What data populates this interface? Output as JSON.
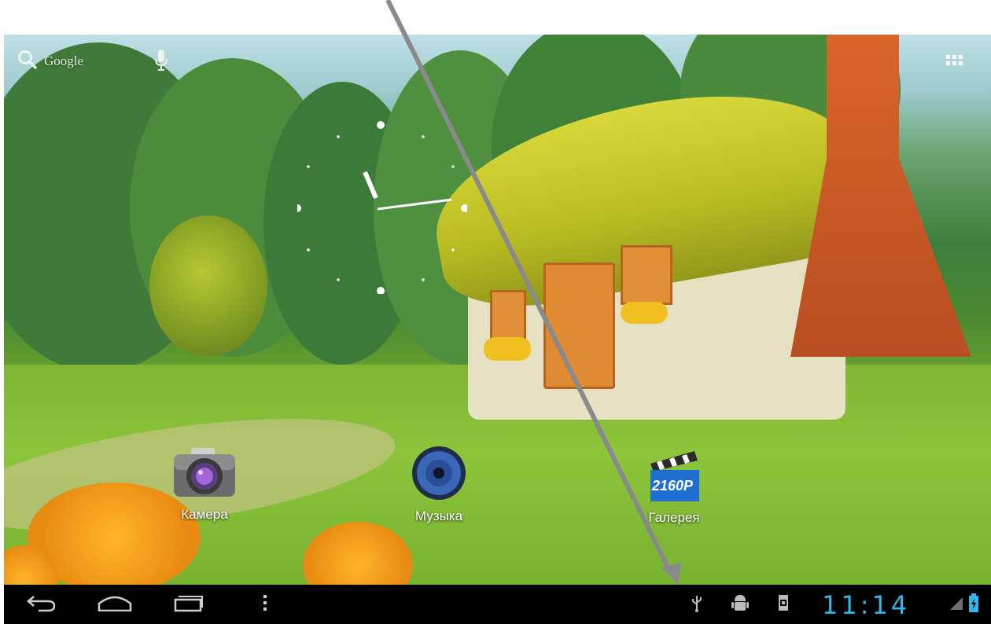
{
  "search": {
    "label": "Google"
  },
  "apps": [
    {
      "label": "Камера",
      "icon": "camera-icon"
    },
    {
      "label": "Музыка",
      "icon": "music-icon"
    },
    {
      "label": "Галерея",
      "icon": "gallery-icon",
      "badge": "2160P"
    }
  ],
  "statusbar": {
    "time": "11:14"
  },
  "colors": {
    "accent": "#33b5e5",
    "navbar": "#000000",
    "annotation_arrow": "#8a8a8a"
  }
}
